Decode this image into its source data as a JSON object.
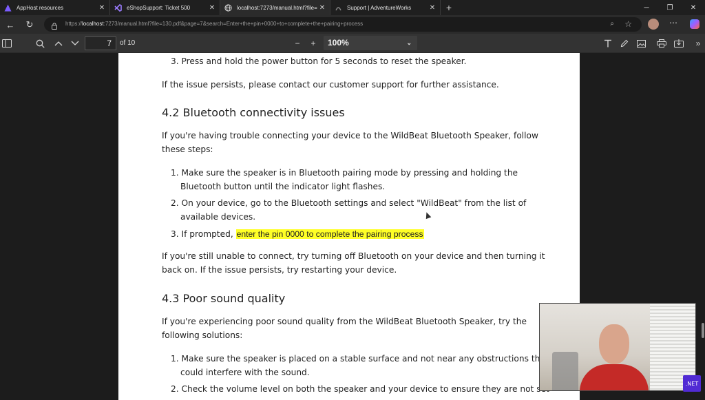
{
  "browser": {
    "tabs": [
      {
        "label": "AppHost resources",
        "icon": "aspire-icon",
        "active": false
      },
      {
        "label": "eShopSupport: Ticket 500",
        "icon": "vs-icon",
        "active": false
      },
      {
        "label": "localhost:7273/manual.html?file=",
        "icon": "globe-icon",
        "active": true
      },
      {
        "label": "Support | AdventureWorks",
        "icon": "page-icon",
        "active": false
      }
    ],
    "new_tab": "+",
    "url_prefix": "https://",
    "url_host": "localhost",
    "url_rest": ":7273/manual.html?file=130.pdf&page=7&search=Enter+the+pin+0000+to+complete+the+pairing+process"
  },
  "pdf_toolbar": {
    "page_current": "7",
    "page_total": "of 10",
    "zoom": "100%"
  },
  "document": {
    "step3_reset": "3. Press and hold the power button for 5 seconds to reset the speaker.",
    "persist_contact": "If the issue persists, please contact our customer support for further assistance.",
    "heading_42": "4.2 Bluetooth connectivity issues",
    "intro_42_line1": "If you're having trouble connecting your device to the WildBeat Bluetooth Speaker, follow",
    "intro_42_line2": "these steps:",
    "step1_line1": "1. Make sure the speaker is in Bluetooth pairing mode by pressing and holding the",
    "step1_line2": "Bluetooth button until the indicator light flashes.",
    "step2_line1": "2. On your device, go to the Bluetooth settings and select \"WildBeat\" from the list of",
    "step2_line2": "available devices.",
    "step3_prefix": "3. If prompted, ",
    "step3_highlight": "enter the pin 0000 to complete the pairing process",
    "unable_line1": "If you're still unable to connect, try turning off Bluetooth on your device and then turning it",
    "unable_line2": "back on. If the issue persists, try restarting your device.",
    "heading_43": "4.3 Poor sound quality",
    "intro_43_line1": "If you're experiencing poor sound quality from the WildBeat Bluetooth Speaker, try the",
    "intro_43_line2": "following solutions:",
    "sq1_line1": "1. Make sure the speaker is placed on a stable surface and not near any obstructions that",
    "sq1_line2": "could interfere with the sound.",
    "sq2_line1": "2. Check the volume level on both the speaker and your device to ensure they are not set"
  },
  "overlay": {
    "badge": ".NET"
  },
  "colors": {
    "highlight": "#ffff27",
    "page_bg": "#ffffff",
    "viewer_bg": "#1c1c1c"
  }
}
